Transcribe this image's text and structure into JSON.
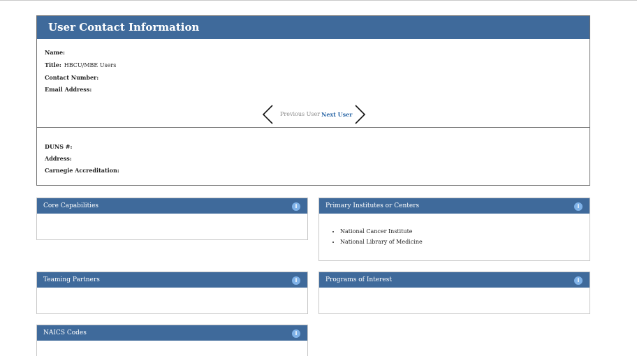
{
  "contact": {
    "title": "User Contact Information",
    "name_label": "Name:",
    "name_value": "",
    "title_label": "Title:",
    "title_value": "HBCU/MBE Users",
    "contact_number_label": "Contact Number:",
    "contact_number_value": "",
    "email_label": "Email Address:",
    "email_value": "",
    "previous_user": "Previous User",
    "next_user": "Next User",
    "duns_label": "DUNS #:",
    "duns_value": "",
    "address_label": "Address:",
    "address_value": "",
    "carnegie_label": "Carnegie Accreditation:",
    "carnegie_value": ""
  },
  "panels": {
    "core_capabilities": {
      "title": "Core Capabilities",
      "info_icon": "i"
    },
    "primary_institutes": {
      "title": "Primary Institutes or Centers",
      "info_icon": "i",
      "items": [
        "National Cancer Institute",
        "National Library of Medicine"
      ]
    },
    "teaming_partners": {
      "title": "Teaming Partners",
      "info_icon": "i"
    },
    "programs_of_interest": {
      "title": "Programs of Interest",
      "info_icon": "i"
    },
    "naics_codes": {
      "title": "NAICS Codes",
      "info_icon": "i"
    }
  },
  "icons": {
    "previous": "chevron-left-icon",
    "next": "chevron-right-icon",
    "info": "info-icon"
  },
  "colors": {
    "header_blue": "#3f6a9b",
    "info_blue": "#7fb2e8",
    "link_blue": "#2f6aa8"
  }
}
